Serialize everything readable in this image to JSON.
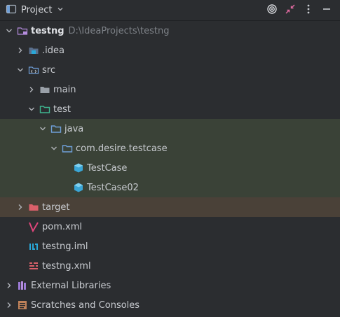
{
  "header": {
    "title": "Project"
  },
  "tree": {
    "root": {
      "label": "testng",
      "path": "D:\\IdeaProjects\\testng"
    },
    "idea": {
      "label": ".idea"
    },
    "src": {
      "label": "src"
    },
    "main": {
      "label": "main"
    },
    "test": {
      "label": "test"
    },
    "java": {
      "label": "java"
    },
    "pkg": {
      "label": "com.desire.testcase"
    },
    "testcase": {
      "label": "TestCase"
    },
    "testcase02": {
      "label": "TestCase02"
    },
    "target": {
      "label": "target"
    },
    "pom": {
      "label": "pom.xml"
    },
    "iml": {
      "label": "testng.iml"
    },
    "testngxml": {
      "label": "testng.xml"
    },
    "extlibs": {
      "label": "External Libraries"
    },
    "scratches": {
      "label": "Scratches and Consoles"
    }
  },
  "colors": {
    "background": "#2b2d30",
    "selection_green": "#3a4237",
    "excluded_brown": "#4a4138",
    "folder_blue": "#6f9fd8",
    "test_folder_green": "#3fb58f",
    "target_folder": "#d9606a"
  },
  "icons": {
    "header": [
      "project-view-icon",
      "chevron-down-icon",
      "locate-icon",
      "collapse-icon",
      "more-options-icon",
      "hide-icon"
    ]
  }
}
